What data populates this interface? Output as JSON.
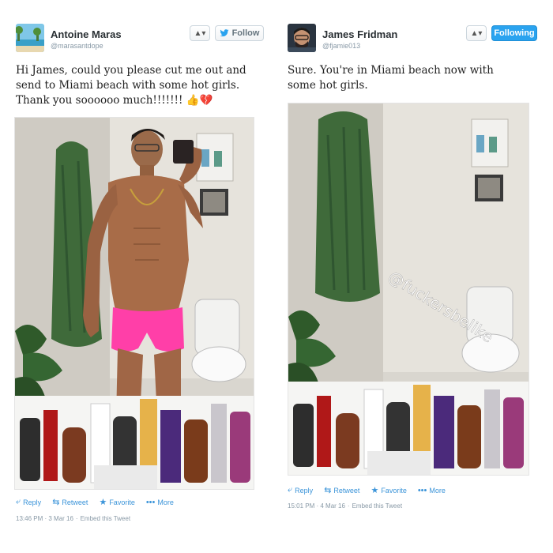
{
  "left_tweet": {
    "name": "Antoine Maras",
    "handle": "@marasantdope",
    "follow_label": "Follow",
    "user_menu": "▲▾",
    "text_lines": [
      "Hi James, could you please cut me out and",
      "send to Miami beach with some hot girls.",
      "Thank you soooooo much!!!!!!! 👍💔"
    ],
    "actions": {
      "reply": "Reply",
      "retweet": "Retweet",
      "favorite": "Favorite",
      "more": "More"
    },
    "timestamp": "13:46 PM · 3 Mar 16",
    "embed": "Embed this Tweet"
  },
  "right_tweet": {
    "name": "James Fridman",
    "handle": "@fjamie013",
    "following_label": "Following",
    "user_menu": "▲▾",
    "text_lines": [
      "Sure. You're in Miami beach now with",
      "some hot girls."
    ],
    "watermark": "@fuckersbelike",
    "actions": {
      "reply": "Reply",
      "retweet": "Retweet",
      "favorite": "Favorite",
      "more": "More"
    },
    "timestamp": "15:01 PM · 4 Mar 16",
    "embed": "Embed this Tweet"
  },
  "colors": {
    "accent": "#2aa3ef",
    "link": "#3b94d9",
    "muted": "#8899a6",
    "swimwear": "#ff3fa8",
    "towel": "#3f6a3a"
  }
}
